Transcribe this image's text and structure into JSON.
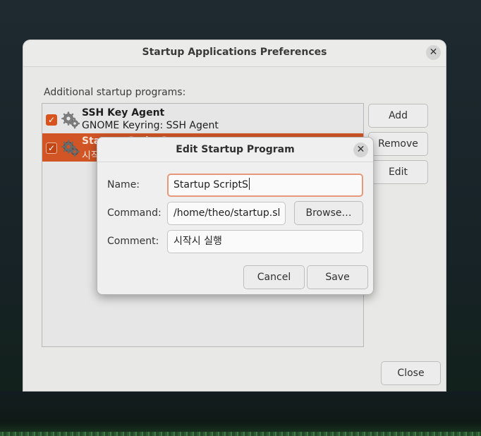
{
  "main_window": {
    "title": "Startup Applications Preferences",
    "section_label": "Additional startup programs:",
    "programs": [
      {
        "name": "SSH Key Agent",
        "description": "GNOME Keyring: SSH Agent",
        "enabled": true,
        "selected": false,
        "icon": "gears-icon"
      },
      {
        "name": "Startup ScriptS",
        "description": "시작시 실행",
        "enabled": true,
        "selected": true,
        "icon": "gears-icon"
      }
    ],
    "buttons": {
      "add": "Add",
      "remove": "Remove",
      "edit": "Edit",
      "close": "Close"
    },
    "close_glyph": "✕"
  },
  "dialog": {
    "title": "Edit Startup Program",
    "close_glyph": "✕",
    "name_label": "Name:",
    "name_value": "Startup ScriptS",
    "command_label": "Command:",
    "command_value": "/home/theo/startup.sl",
    "browse_label": "Browse…",
    "comment_label": "Comment:",
    "comment_value": "시작시 실행",
    "cancel_label": "Cancel",
    "save_label": "Save"
  },
  "colors": {
    "accent": "#d9531f",
    "selection": "#d25525",
    "focus_ring": "#e7987a"
  }
}
